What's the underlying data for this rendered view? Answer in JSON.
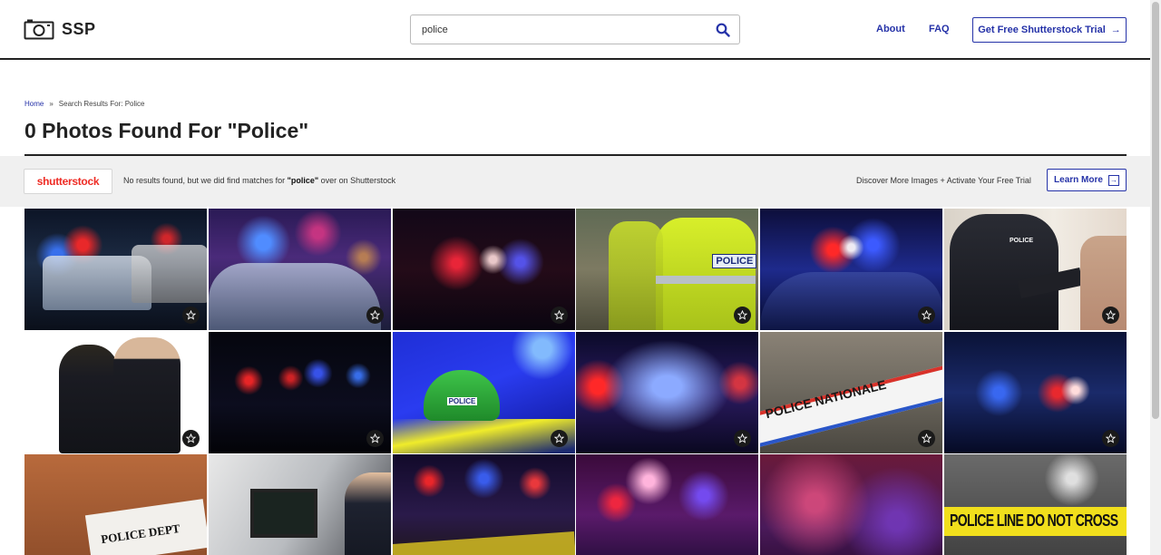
{
  "header": {
    "logo_text": "SSP",
    "search_value": "police",
    "nav": {
      "about": "About",
      "faq": "FAQ"
    },
    "trial_button": "Get Free Shutterstock Trial",
    "trial_arrow": "→"
  },
  "breadcrumb": {
    "home": "Home",
    "separator": "»",
    "current": "Search Results For: Police"
  },
  "page_title": "0 Photos Found For \"Police\"",
  "promo": {
    "logo_text": "shutterstock",
    "message_prefix": "No results found, but we did find matches for ",
    "message_term": "\"police\"",
    "message_suffix": " over on Shutterstock",
    "right_text": "Discover More Images + Activate Your Free Trial",
    "learn_more": "Learn More"
  },
  "tiles": [
    {
      "label": ""
    },
    {
      "label": ""
    },
    {
      "label": ""
    },
    {
      "label": "POLICE"
    },
    {
      "label": ""
    },
    {
      "label": "POLICE"
    },
    {
      "label": ""
    },
    {
      "label": ""
    },
    {
      "label": "POLICE"
    },
    {
      "label": ""
    },
    {
      "label": "POLICE NATIONALE"
    },
    {
      "label": ""
    },
    {
      "label": "POLICE DEPT"
    },
    {
      "label": ""
    },
    {
      "label": ""
    },
    {
      "label": ""
    },
    {
      "label": ""
    },
    {
      "label": "POLICE LINE DO NOT CROSS"
    }
  ],
  "colors": {
    "accent": "#2532a8",
    "shutterstock_red": "#ee2b24",
    "promo_bg": "#f0f0f0"
  }
}
